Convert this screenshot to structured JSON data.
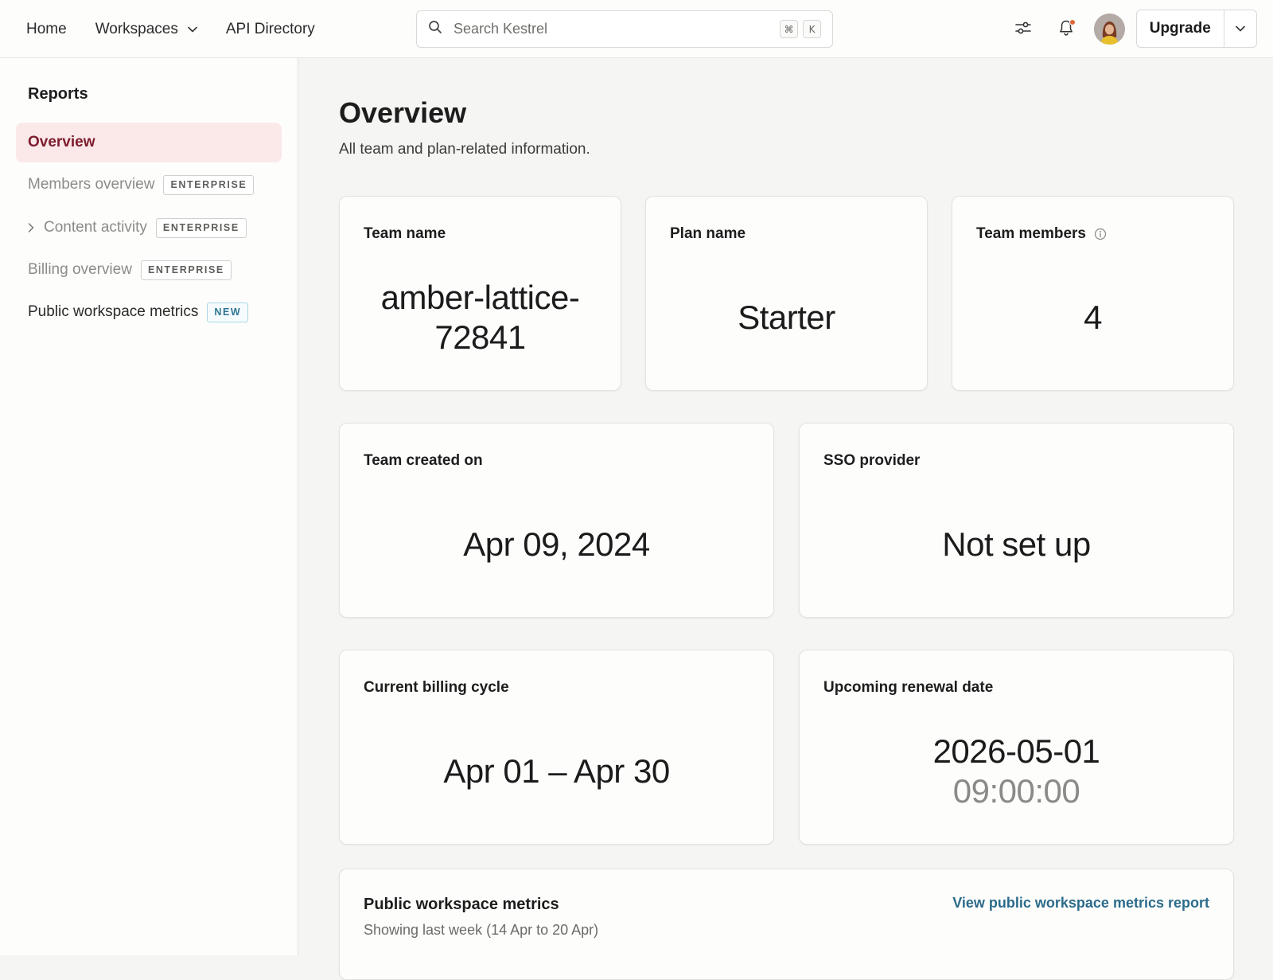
{
  "topbar": {
    "nav": [
      {
        "label": "Home"
      },
      {
        "label": "Workspaces",
        "has_dropdown": true
      },
      {
        "label": "API Directory"
      }
    ],
    "search": {
      "placeholder": "Search Kestrel",
      "shortcut_keys": [
        "⌘",
        "K"
      ]
    },
    "icons": {
      "filter": "sliders-icon",
      "notifications": "bell-icon",
      "notification_dot_color": "#e0663a"
    },
    "upgrade_label": "Upgrade"
  },
  "sidebar": {
    "heading": "Reports",
    "items": [
      {
        "label": "Overview",
        "state": "active"
      },
      {
        "label": "Members overview",
        "badge": "ENTERPRISE",
        "state": "muted"
      },
      {
        "label": "Content activity",
        "badge": "ENTERPRISE",
        "state": "muted",
        "expandable": true
      },
      {
        "label": "Billing overview",
        "badge": "ENTERPRISE",
        "state": "muted"
      },
      {
        "label": "Public workspace metrics",
        "badge": "NEW",
        "state": "normal"
      }
    ]
  },
  "main": {
    "title": "Overview",
    "subtitle": "All team and plan-related information.",
    "cards": {
      "team_name": {
        "label": "Team name",
        "value_line1": "amber-lattice-",
        "value_line2": "72841"
      },
      "plan_name": {
        "label": "Plan name",
        "value": "Starter"
      },
      "team_members": {
        "label": "Team members",
        "value": "4"
      },
      "team_created": {
        "label": "Team created on",
        "value": "Apr 09, 2024"
      },
      "sso_provider": {
        "label": "SSO provider",
        "value": "Not set up"
      },
      "billing_cycle": {
        "label": "Current billing cycle",
        "value": "Apr 01 – Apr 30"
      },
      "renewal": {
        "label": "Upcoming renewal date",
        "date": "2026-05-01",
        "time": "09:00:00"
      }
    },
    "metrics": {
      "title": "Public workspace metrics",
      "subtitle": "Showing last week (14 Apr to 20 Apr)",
      "link": "View public workspace metrics report"
    }
  },
  "colors": {
    "accent_active_bg": "#fbe9ea",
    "accent_active_text": "#7d1c2c",
    "link": "#2c6b8a"
  }
}
